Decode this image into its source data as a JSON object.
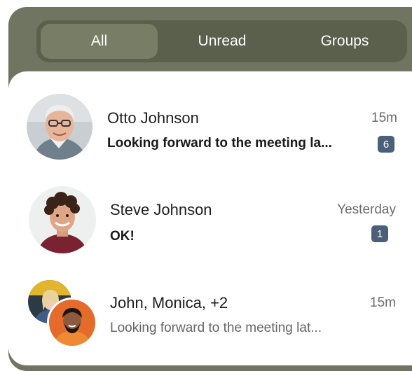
{
  "tabs": [
    {
      "label": "All",
      "active": true
    },
    {
      "label": "Unread",
      "active": false
    },
    {
      "label": "Groups",
      "active": false
    }
  ],
  "conversations": [
    {
      "name": "Otto Johnson",
      "time": "15m",
      "message": "Looking forward to the meeting la...",
      "unread_count": "6",
      "avatar": "elderly-man-photo"
    },
    {
      "name": "Steve Johnson",
      "time": "Yesterday",
      "message": "OK!",
      "unread_count": "1",
      "avatar": "young-man-curly-hair-photo"
    },
    {
      "name": "John, Monica, +2",
      "time": "15m",
      "message": "Looking forward to the meeting lat...",
      "avatar": "group-photos"
    }
  ],
  "colors": {
    "frame": "#6f7560",
    "tab_track": "#5a604c",
    "tab_active": "#777e65",
    "badge": "#4b5f78"
  }
}
